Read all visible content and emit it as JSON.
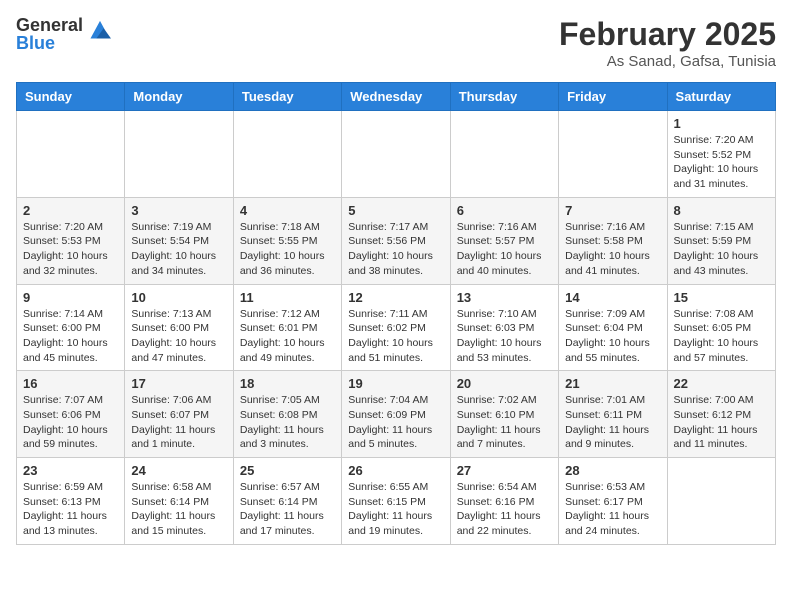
{
  "header": {
    "logo_general": "General",
    "logo_blue": "Blue",
    "title": "February 2025",
    "location": "As Sanad, Gafsa, Tunisia"
  },
  "calendar": {
    "days_of_week": [
      "Sunday",
      "Monday",
      "Tuesday",
      "Wednesday",
      "Thursday",
      "Friday",
      "Saturday"
    ],
    "weeks": [
      [
        {
          "day": "",
          "info": ""
        },
        {
          "day": "",
          "info": ""
        },
        {
          "day": "",
          "info": ""
        },
        {
          "day": "",
          "info": ""
        },
        {
          "day": "",
          "info": ""
        },
        {
          "day": "",
          "info": ""
        },
        {
          "day": "1",
          "info": "Sunrise: 7:20 AM\nSunset: 5:52 PM\nDaylight: 10 hours and 31 minutes."
        }
      ],
      [
        {
          "day": "2",
          "info": "Sunrise: 7:20 AM\nSunset: 5:53 PM\nDaylight: 10 hours and 32 minutes."
        },
        {
          "day": "3",
          "info": "Sunrise: 7:19 AM\nSunset: 5:54 PM\nDaylight: 10 hours and 34 minutes."
        },
        {
          "day": "4",
          "info": "Sunrise: 7:18 AM\nSunset: 5:55 PM\nDaylight: 10 hours and 36 minutes."
        },
        {
          "day": "5",
          "info": "Sunrise: 7:17 AM\nSunset: 5:56 PM\nDaylight: 10 hours and 38 minutes."
        },
        {
          "day": "6",
          "info": "Sunrise: 7:16 AM\nSunset: 5:57 PM\nDaylight: 10 hours and 40 minutes."
        },
        {
          "day": "7",
          "info": "Sunrise: 7:16 AM\nSunset: 5:58 PM\nDaylight: 10 hours and 41 minutes."
        },
        {
          "day": "8",
          "info": "Sunrise: 7:15 AM\nSunset: 5:59 PM\nDaylight: 10 hours and 43 minutes."
        }
      ],
      [
        {
          "day": "9",
          "info": "Sunrise: 7:14 AM\nSunset: 6:00 PM\nDaylight: 10 hours and 45 minutes."
        },
        {
          "day": "10",
          "info": "Sunrise: 7:13 AM\nSunset: 6:00 PM\nDaylight: 10 hours and 47 minutes."
        },
        {
          "day": "11",
          "info": "Sunrise: 7:12 AM\nSunset: 6:01 PM\nDaylight: 10 hours and 49 minutes."
        },
        {
          "day": "12",
          "info": "Sunrise: 7:11 AM\nSunset: 6:02 PM\nDaylight: 10 hours and 51 minutes."
        },
        {
          "day": "13",
          "info": "Sunrise: 7:10 AM\nSunset: 6:03 PM\nDaylight: 10 hours and 53 minutes."
        },
        {
          "day": "14",
          "info": "Sunrise: 7:09 AM\nSunset: 6:04 PM\nDaylight: 10 hours and 55 minutes."
        },
        {
          "day": "15",
          "info": "Sunrise: 7:08 AM\nSunset: 6:05 PM\nDaylight: 10 hours and 57 minutes."
        }
      ],
      [
        {
          "day": "16",
          "info": "Sunrise: 7:07 AM\nSunset: 6:06 PM\nDaylight: 10 hours and 59 minutes."
        },
        {
          "day": "17",
          "info": "Sunrise: 7:06 AM\nSunset: 6:07 PM\nDaylight: 11 hours and 1 minute."
        },
        {
          "day": "18",
          "info": "Sunrise: 7:05 AM\nSunset: 6:08 PM\nDaylight: 11 hours and 3 minutes."
        },
        {
          "day": "19",
          "info": "Sunrise: 7:04 AM\nSunset: 6:09 PM\nDaylight: 11 hours and 5 minutes."
        },
        {
          "day": "20",
          "info": "Sunrise: 7:02 AM\nSunset: 6:10 PM\nDaylight: 11 hours and 7 minutes."
        },
        {
          "day": "21",
          "info": "Sunrise: 7:01 AM\nSunset: 6:11 PM\nDaylight: 11 hours and 9 minutes."
        },
        {
          "day": "22",
          "info": "Sunrise: 7:00 AM\nSunset: 6:12 PM\nDaylight: 11 hours and 11 minutes."
        }
      ],
      [
        {
          "day": "23",
          "info": "Sunrise: 6:59 AM\nSunset: 6:13 PM\nDaylight: 11 hours and 13 minutes."
        },
        {
          "day": "24",
          "info": "Sunrise: 6:58 AM\nSunset: 6:14 PM\nDaylight: 11 hours and 15 minutes."
        },
        {
          "day": "25",
          "info": "Sunrise: 6:57 AM\nSunset: 6:14 PM\nDaylight: 11 hours and 17 minutes."
        },
        {
          "day": "26",
          "info": "Sunrise: 6:55 AM\nSunset: 6:15 PM\nDaylight: 11 hours and 19 minutes."
        },
        {
          "day": "27",
          "info": "Sunrise: 6:54 AM\nSunset: 6:16 PM\nDaylight: 11 hours and 22 minutes."
        },
        {
          "day": "28",
          "info": "Sunrise: 6:53 AM\nSunset: 6:17 PM\nDaylight: 11 hours and 24 minutes."
        },
        {
          "day": "",
          "info": ""
        }
      ]
    ]
  }
}
